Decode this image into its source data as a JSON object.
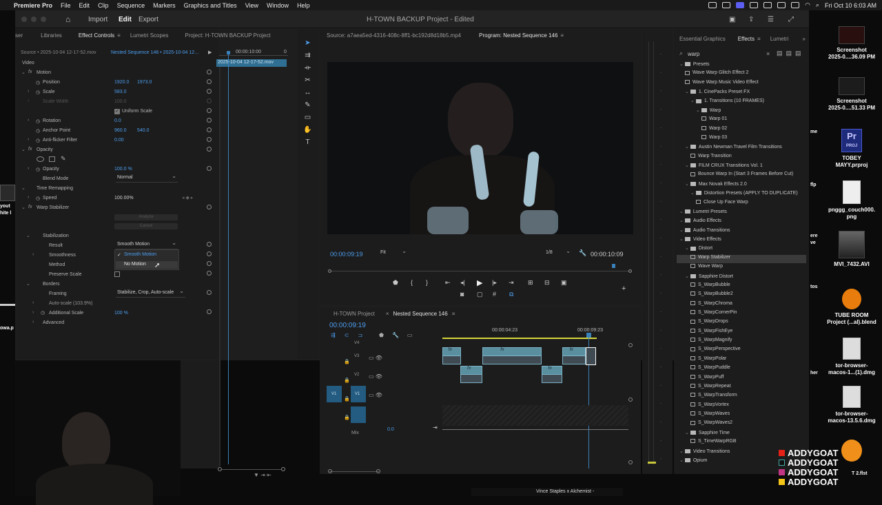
{
  "menubar": {
    "app": "Premiere Pro",
    "items": [
      "File",
      "Edit",
      "Clip",
      "Sequence",
      "Markers",
      "Graphics and Titles",
      "View",
      "Window",
      "Help"
    ],
    "datetime": "Fri Oct 10  6:03 AM"
  },
  "titlebar": {
    "import": "Import",
    "edit": "Edit",
    "export": "Export",
    "title": "H-TOWN BACKUP Project - Edited"
  },
  "effect_controls": {
    "tabs": [
      "ser",
      "Libraries",
      "Effect Controls",
      "Lumetri Scopes",
      "Project: H-TOWN BACKUP Project"
    ],
    "source": "Source • 2025-10-04 12-17-52.mov",
    "sequence": "Nested Sequence 146 • 2025-10-04 12…",
    "timecode": "00:00:10:00",
    "timecode_end": "0",
    "clip_name": "2025-10-04 12-17-52.mov",
    "video": "Video",
    "motion": "Motion",
    "position": "Position",
    "position_x": "1920.0",
    "position_y": "1973.0",
    "scale": "Scale",
    "scale_v": "583.0",
    "scale_width": "Scale Width",
    "scale_width_v": "100.0",
    "uniform_scale": "Uniform Scale",
    "rotation": "Rotation",
    "rotation_v": "0.0",
    "anchor": "Anchor Point",
    "anchor_x": "960.0",
    "anchor_y": "540.0",
    "antiflicker": "Anti-flicker Filter",
    "antiflicker_v": "0.00",
    "opacity_group": "Opacity",
    "opacity": "Opacity",
    "opacity_v": "100.0 %",
    "blend": "Blend Mode",
    "blend_v": "Normal",
    "time_remap": "Time Remapping",
    "speed": "Speed",
    "speed_v": "100.00%",
    "warp": "Warp Stabilizer",
    "analyze": "Analyze",
    "cancel": "Cancel",
    "stabilization": "Stabilization",
    "result": "Result",
    "result_v": "Smooth Motion",
    "smoothness": "Smoothness",
    "method": "Method",
    "preserve": "Preserve Scale",
    "borders": "Borders",
    "framing": "Framing",
    "framing_v": "Stabilize, Crop, Auto-scale",
    "autoscale": "Auto-scale (103.9%)",
    "additional": "Additional Scale",
    "additional_v": "100 %",
    "advanced": "Advanced",
    "menu": [
      "Smooth Motion",
      "No Motion"
    ]
  },
  "source_tab": "Source: a7aea5ed-4316-408c-8ff1-bc192d8d18b5.mp4",
  "program": {
    "tab": "Program: Nested Sequence 146",
    "tc": "00:00:09:19",
    "fit": "Fit",
    "res": "1/8",
    "dur": "00:00:10:09"
  },
  "timeline": {
    "tabs": [
      "H-TOWN Project",
      "Nested Sequence 146"
    ],
    "tc": "00:00:09:19",
    "ruler": [
      "00:00:04:23",
      "00:00:09:23"
    ],
    "tracks": [
      "V4",
      "V3",
      "V2",
      "V1"
    ],
    "mix": "Mix",
    "mix_v": "0.0"
  },
  "effects": {
    "tabs": [
      "Essential Graphics",
      "Effects",
      "Lumetri"
    ],
    "search": "warp",
    "items": [
      {
        "t": "Presets",
        "d": 0,
        "f": 1
      },
      {
        "t": "Wave Warp Glitch Effect 2",
        "d": 1
      },
      {
        "t": "Wave Warp Music Video Effect",
        "d": 1
      },
      {
        "t": "1. CinePacks Preset FX",
        "d": 1,
        "f": 1
      },
      {
        "t": "1. Transitions (10 FRAMES)",
        "d": 2,
        "f": 1
      },
      {
        "t": "Warp",
        "d": 3,
        "f": 1
      },
      {
        "t": "Warp 01",
        "d": 4
      },
      {
        "t": "Warp 02",
        "d": 4
      },
      {
        "t": "Warp 03",
        "d": 4
      },
      {
        "t": "Austin Newman Travel Film Transitions",
        "d": 1,
        "f": 1
      },
      {
        "t": "Warp Transition",
        "d": 2
      },
      {
        "t": "FILM CRUX Transitions Vol. 1",
        "d": 1,
        "f": 1
      },
      {
        "t": "Bounce Warp In (Start 3 Frames Before Cut)",
        "d": 2
      },
      {
        "t": "Max Novak Effects 2.0",
        "d": 1,
        "f": 1
      },
      {
        "t": "Distortion Presets (APPLY TO DUPLICATE)",
        "d": 2,
        "f": 1
      },
      {
        "t": "Close Up Face Warp",
        "d": 3
      },
      {
        "t": "Lumetri Presets",
        "d": 0,
        "f": 1
      },
      {
        "t": "Audio Effects",
        "d": 0,
        "f": 1
      },
      {
        "t": "Audio Transitions",
        "d": 0,
        "f": 1
      },
      {
        "t": "Video Effects",
        "d": 0,
        "f": 1
      },
      {
        "t": "Distort",
        "d": 1,
        "f": 1
      },
      {
        "t": "Warp Stabilizer",
        "d": 2,
        "sel": 1
      },
      {
        "t": "Wave Warp",
        "d": 2
      },
      {
        "t": "Sapphire Distort",
        "d": 1,
        "f": 1
      },
      {
        "t": "S_WarpBubble",
        "d": 2
      },
      {
        "t": "S_WarpBubble2",
        "d": 2
      },
      {
        "t": "S_WarpChroma",
        "d": 2
      },
      {
        "t": "S_WarpCornerPin",
        "d": 2
      },
      {
        "t": "S_WarpDrops",
        "d": 2
      },
      {
        "t": "S_WarpFishEye",
        "d": 2
      },
      {
        "t": "S_WarpMagnify",
        "d": 2
      },
      {
        "t": "S_WarpPerspective",
        "d": 2
      },
      {
        "t": "S_WarpPolar",
        "d": 2
      },
      {
        "t": "S_WarpPuddle",
        "d": 2
      },
      {
        "t": "S_WarpPuff",
        "d": 2
      },
      {
        "t": "S_WarpRepeat",
        "d": 2
      },
      {
        "t": "S_WarpTransform",
        "d": 2
      },
      {
        "t": "S_WarpVortex",
        "d": 2
      },
      {
        "t": "S_WarpWaves",
        "d": 2
      },
      {
        "t": "S_WarpWaves2",
        "d": 2
      },
      {
        "t": "Sapphire Time",
        "d": 1,
        "f": 1
      },
      {
        "t": "S_TimeWarpRGB",
        "d": 2
      },
      {
        "t": "Video Transitions",
        "d": 0,
        "f": 1
      },
      {
        "t": "Opium",
        "d": 0,
        "f": 1
      }
    ]
  },
  "desktop": [
    {
      "l1": "Screenshot",
      "l2": "2025-0....36.09 PM"
    },
    {
      "l1": "Screenshot",
      "l2": "2025-0....51.33 PM"
    },
    {
      "l1": "TOBEY",
      "l2": "MAYY.prproj",
      "icon": "PROJ"
    },
    {
      "l1": "pnggg_couch000.",
      "l2": "png"
    },
    {
      "l1": "MVI_7432.AVI",
      "l2": ""
    },
    {
      "l1": "TUBE ROOM",
      "l2": "Project (...al).blend"
    },
    {
      "l1": "tor-browser-",
      "l2": "macos-1...(1).dmg"
    },
    {
      "l1": "tor-browser-",
      "l2": "macos-13.5.6.dmg"
    },
    {
      "l1": "T 2.flst",
      "l2": ""
    }
  ],
  "watermark": [
    "ADDYGOAT",
    "ADDYGOAT",
    "ADDYGOAT",
    "ADDYGOAT"
  ],
  "bottom_text": "Vince Staples x Alchemist -",
  "left_fragments": [
    "yout",
    "hite l",
    "owa.p"
  ],
  "right_fragments": [
    "me",
    "flp",
    "ere",
    "ve",
    "tos",
    "her"
  ]
}
